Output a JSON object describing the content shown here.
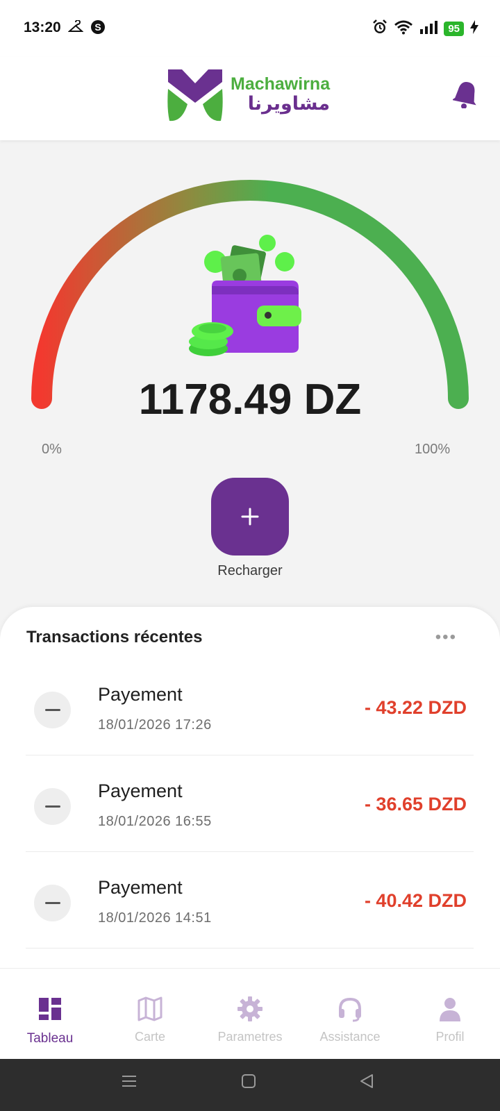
{
  "status_bar": {
    "time": "13:20",
    "battery": "95",
    "icons": [
      "hanger-icon",
      "s-badge-icon",
      "alarm-icon",
      "wifi-icon",
      "signal-icon",
      "battery-icon",
      "charging-icon"
    ]
  },
  "header": {
    "brand_latin": "Machawirna",
    "brand_arabic": "مشاويرنا",
    "notification_icon": "bell-icon"
  },
  "wallet": {
    "balance": "1178.49 DZ",
    "gauge_min_label": "0%",
    "gauge_max_label": "100%",
    "gauge_level": 1.0,
    "illustration": "wallet-with-cash-icon",
    "recharge_label": "Recharger",
    "recharge_symbol": "+"
  },
  "transactions": {
    "title": "Transactions récentes",
    "more_label": "•••",
    "items": [
      {
        "label": "Payement",
        "date": "18/01/2026 17:26",
        "amount": "- 43.22 DZD"
      },
      {
        "label": "Payement",
        "date": "18/01/2026 16:55",
        "amount": "- 36.65 DZD"
      },
      {
        "label": "Payement",
        "date": "18/01/2026 14:51",
        "amount": "- 40.42 DZD"
      }
    ]
  },
  "bottom_nav": {
    "items": [
      {
        "label": "Tableau",
        "icon": "dashboard-icon",
        "active": true
      },
      {
        "label": "Carte",
        "icon": "map-icon",
        "active": false
      },
      {
        "label": "Parametres",
        "icon": "gear-icon",
        "active": false
      },
      {
        "label": "Assistance",
        "icon": "headset-icon",
        "active": false
      },
      {
        "label": "Profil",
        "icon": "person-icon",
        "active": false
      }
    ]
  },
  "colors": {
    "brand_purple": "#6a3190",
    "brand_green": "#4cae3f",
    "negative_amount": "#e0402c",
    "gauge_start": "#f2392f",
    "gauge_end": "#4caf50"
  }
}
